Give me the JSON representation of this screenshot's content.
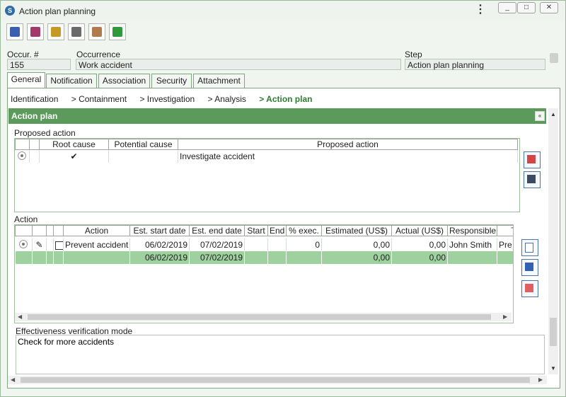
{
  "window": {
    "title": "Action plan planning",
    "minimize": "_",
    "restore": "□",
    "close": "✕",
    "menu_icon": "⋮"
  },
  "toolbar": {
    "buttons": [
      {
        "name": "save",
        "icon": "floppy-icon",
        "color": "#3b5fb0"
      },
      {
        "name": "save-exit",
        "icon": "floppy-x-icon",
        "color": "#a33b6a"
      },
      {
        "name": "gift",
        "icon": "gift-icon",
        "color": "#c49a24"
      },
      {
        "name": "search-doc",
        "icon": "binoculars-doc-icon",
        "color": "#6a6a6a"
      },
      {
        "name": "user-doc",
        "icon": "user-doc-icon",
        "color": "#b07a4a"
      },
      {
        "name": "refresh",
        "icon": "refresh-icon",
        "color": "#2f9a3a"
      }
    ]
  },
  "header": {
    "occur_label": "Occur. #",
    "occur_value": "155",
    "occurrence_label": "Occurrence",
    "occurrence_value": "Work accident",
    "step_label": "Step",
    "step_value": "Action plan planning"
  },
  "tabs": [
    "General",
    "Notification",
    "Association",
    "Security",
    "Attachment"
  ],
  "breadcrumb": [
    "Identification",
    "> Containment",
    "> Investigation",
    "> Analysis",
    "> Action plan"
  ],
  "section": {
    "title": "Action plan",
    "collapse_icon": "«"
  },
  "proposed": {
    "label": "Proposed action",
    "columns": [
      "",
      "",
      "Root cause",
      "Potential cause",
      "Proposed action"
    ],
    "rows": [
      {
        "root_cause": "✔",
        "potential_cause": "",
        "proposed_action": "Investigate accident"
      }
    ]
  },
  "action": {
    "label": "Action",
    "columns": [
      "",
      "",
      "",
      "",
      "Action",
      "Est. start date",
      "Est. end date",
      "Start",
      "End",
      "% exec.",
      "Estimated (US$)",
      "Actual (US$)",
      "Responsible",
      "Typ"
    ],
    "rows": [
      {
        "action": "Prevent accident",
        "est_start": "06/02/2019",
        "est_end": "07/02/2019",
        "start": "",
        "end": "",
        "exec": "0",
        "estimated": "0,00",
        "actual": "0,00",
        "responsible": "John Smith",
        "type": "Pre"
      }
    ],
    "totals": {
      "est_start": "06/02/2019",
      "est_end": "07/02/2019",
      "estimated": "0,00",
      "actual": "0,00"
    }
  },
  "effectiveness": {
    "label": "Effectiveness verification mode",
    "value": "Check for more accidents"
  }
}
